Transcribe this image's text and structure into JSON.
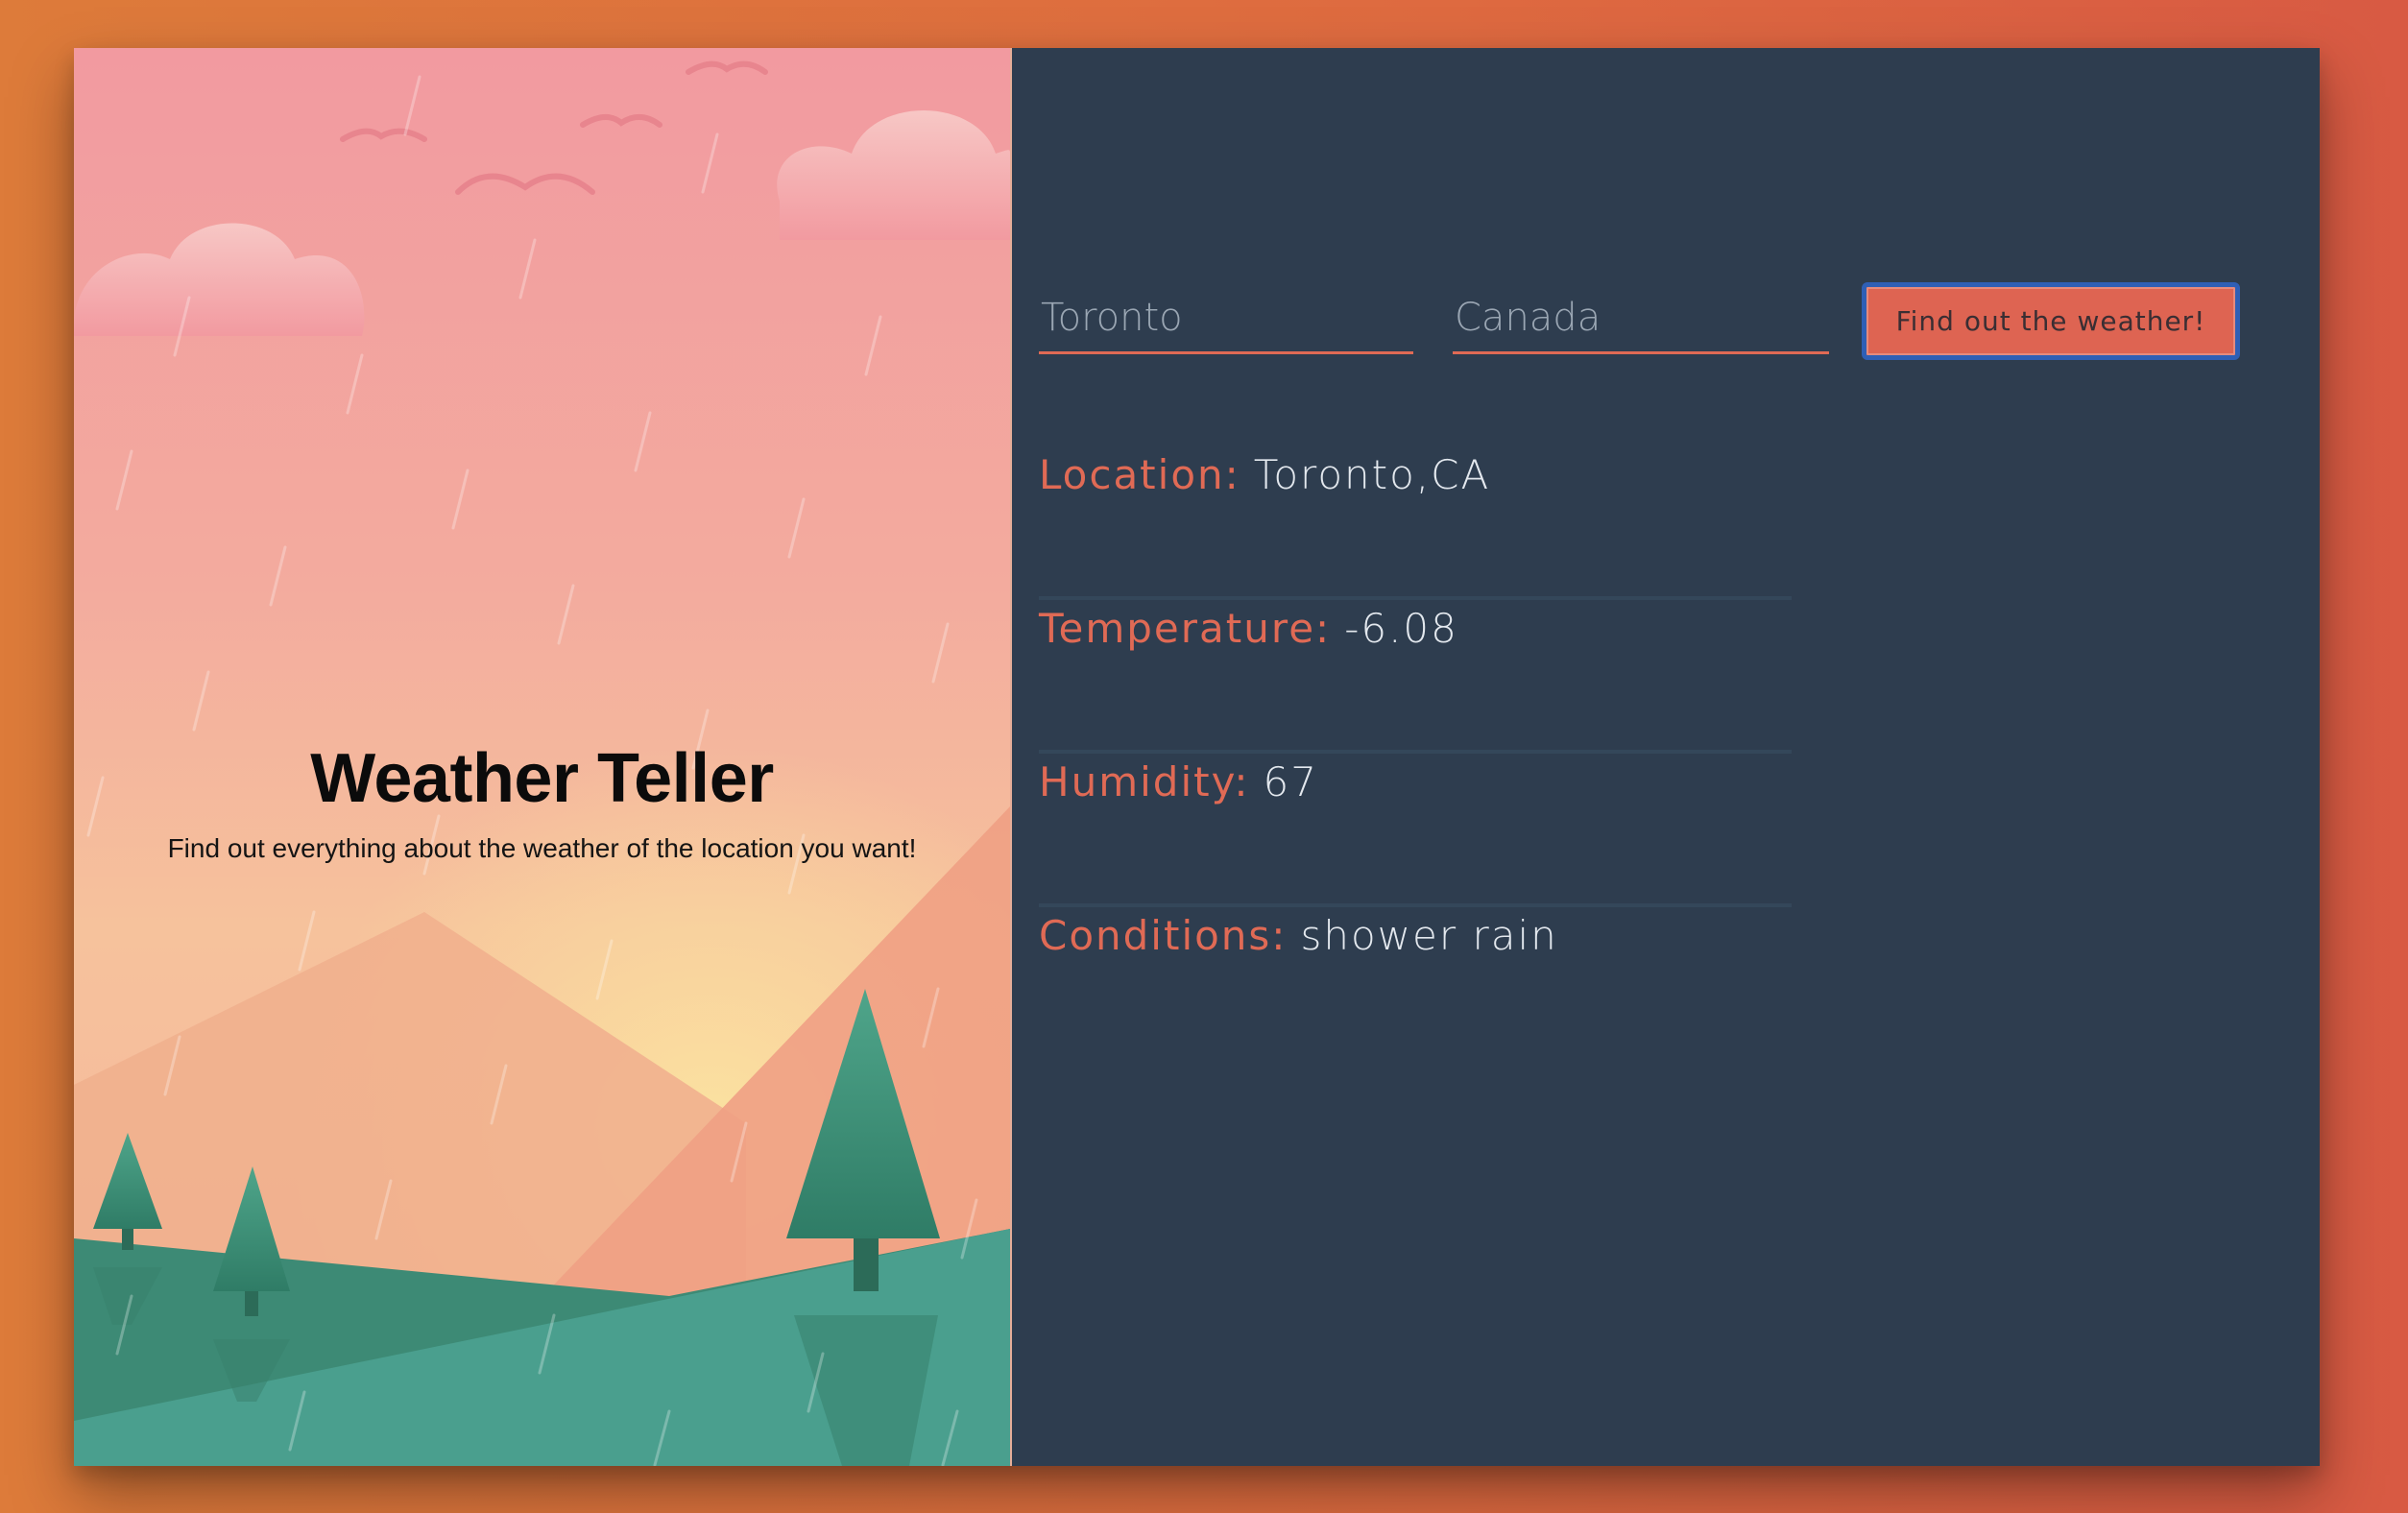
{
  "hero": {
    "title": "Weather Teller",
    "subtitle": "Find out everything about the weather of the location you want!"
  },
  "form": {
    "city_placeholder": "Toronto",
    "country_placeholder": "Canada",
    "submit_label": "Find out the weather!"
  },
  "results": [
    {
      "label": "Location:",
      "value": "Toronto,CA"
    },
    {
      "label": "Temperature:",
      "value": "-6.08"
    },
    {
      "label": "Humidity:",
      "value": "67"
    },
    {
      "label": "Conditions:",
      "value": "shower rain"
    }
  ],
  "colors": {
    "page_background": "#de6f3f",
    "panel_background": "#2e3d4f",
    "accent": "#e06a55",
    "button_focus_ring": "#2f5fb5"
  },
  "illustration": {
    "subject": "rainy pink sky with clouds, birds, mountains, sun glow and pine trees",
    "icons": [
      "cloud-icon",
      "bird-icon",
      "mountain-icon",
      "pine-tree-icon",
      "rain-icon"
    ]
  }
}
